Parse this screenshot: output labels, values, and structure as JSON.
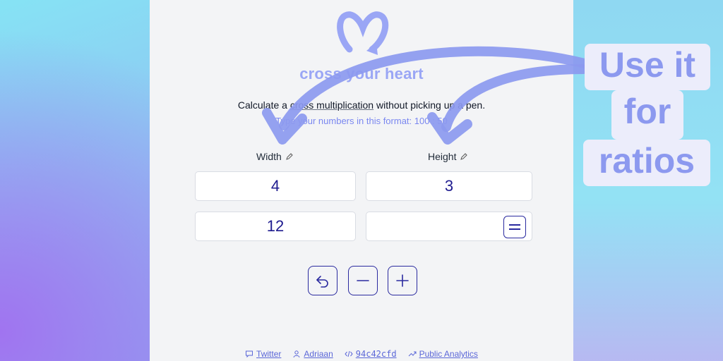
{
  "app": {
    "title": "cross your heart",
    "intro_before": "Calculate a ",
    "intro_link": "cross multiplication",
    "intro_after": " without picking up a pen.",
    "hint": "Type your numbers in this format: 100 : 50"
  },
  "columns": {
    "left_label": "Width",
    "right_label": "Height"
  },
  "fields": {
    "a": "4",
    "b": "3",
    "c": "12",
    "d": ""
  },
  "footer": {
    "twitter": "Twitter",
    "author": "Adriaan",
    "commit": "94c42cfd",
    "analytics": "Public Analytics"
  },
  "callout": {
    "line1": "Use it",
    "line2": "for",
    "line3": "ratios"
  },
  "colors": {
    "accent": "#8c99ef",
    "ink": "#1e1b8f",
    "button": "#2a2a9f"
  }
}
